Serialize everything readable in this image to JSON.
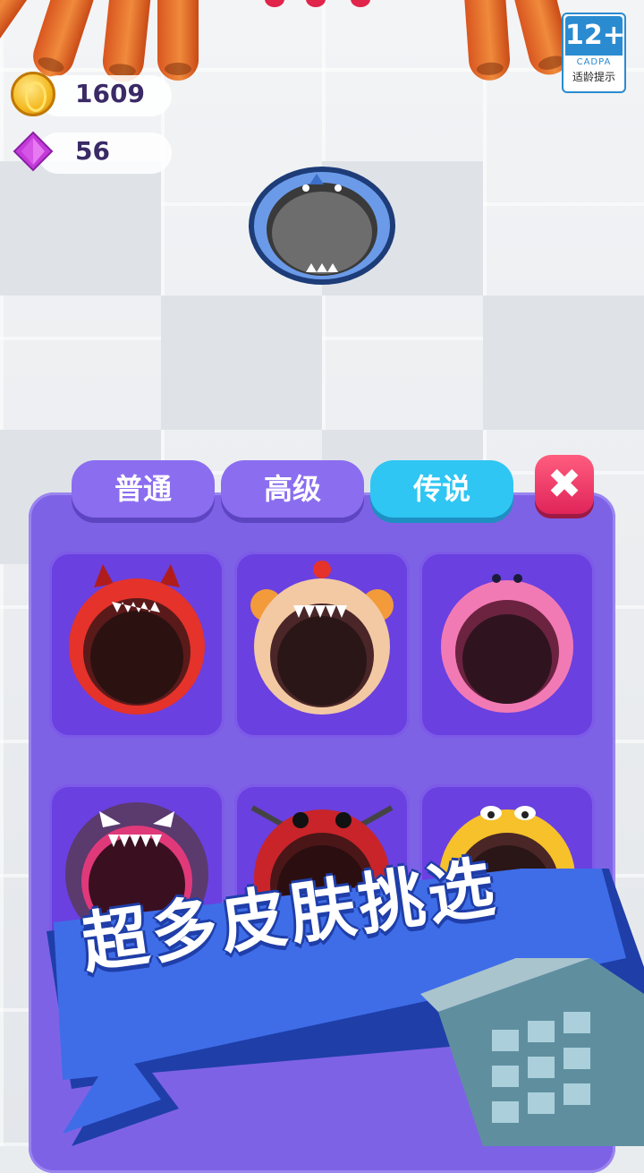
{
  "hud": {
    "coins": "1609",
    "gems": "56"
  },
  "age_rating": {
    "rating": "12+",
    "org": "CADPA",
    "label": "适龄提示"
  },
  "skin_shop": {
    "tabs": [
      {
        "label": "普通",
        "active": false
      },
      {
        "label": "高级",
        "active": false
      },
      {
        "label": "传说",
        "active": true
      }
    ],
    "skins": [
      {
        "name": "red-dragon",
        "ring": "#e5322a"
      },
      {
        "name": "clown",
        "ring": "#f3c9a3"
      },
      {
        "name": "pink-puff",
        "ring": "#f27ab4"
      },
      {
        "name": "purple-monster",
        "ring": "#5b3a6e"
      },
      {
        "name": "ninja-red",
        "ring": "#c8242a"
      },
      {
        "name": "yellow-fish",
        "ring": "#f6c12a"
      }
    ]
  },
  "promo_banner": {
    "text": "超多皮肤挑选"
  },
  "colors": {
    "panel": "#7e62e6",
    "tab_active": "#2fc6f3",
    "close": "#e0245a",
    "banner": "#3f6de8"
  }
}
